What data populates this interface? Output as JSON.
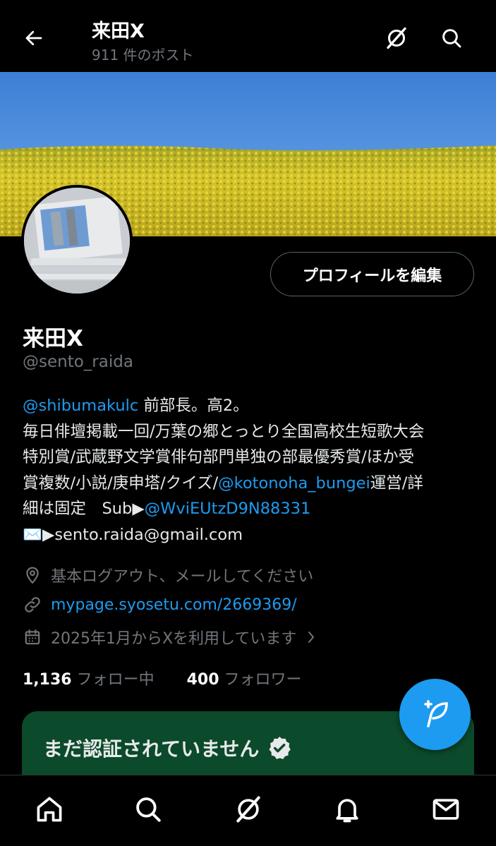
{
  "header": {
    "title": "来田X",
    "post_count": "911 件のポスト"
  },
  "profile": {
    "edit_button": "プロフィールを編集",
    "display_name": "来田X",
    "handle": "@sento_raida"
  },
  "bio": {
    "line1_mention": "@shibumakulc",
    "line1_text": " 前部長。高2。",
    "line2": "毎日俳壇掲載一回/万葉の郷とっとり全国高校生短歌大会",
    "line3": "特別賞/武蔵野文学賞俳句部門単独の部最優秀賞/ほか受",
    "line4_text": "賞複数/小説/庚申塔/クイズ/",
    "line4_mention": "@kotonoha_bungei",
    "line4_tail": "運営/詳",
    "line5_text": "細は固定　Sub▶",
    "line5_mention": "@WviEUtzD9N88331",
    "line6": "✉️▶sento.raida@gmail.com"
  },
  "meta": {
    "location": "基本ログアウト、メールしてください",
    "website": "mypage.syosetu.com/2669369/",
    "joined": "2025年1月からXを利用しています"
  },
  "stats": {
    "following_count": "1,136",
    "following_label": "フォロー中",
    "followers_count": "400",
    "followers_label": "フォロワー"
  },
  "verify": {
    "text": "まだ認証されていません"
  },
  "icons": {
    "back": "arrow-left-icon",
    "grok": "grok-icon",
    "search": "search-icon",
    "location": "location-pin-icon",
    "link": "link-icon",
    "calendar": "calendar-icon",
    "compose": "compose-icon",
    "home": "home-icon",
    "notifications": "bell-icon",
    "messages": "envelope-icon"
  },
  "colors": {
    "background": "#000000",
    "accent": "#1d9bf0",
    "muted": "#71767b",
    "verify_card": "#0b4a2a"
  }
}
